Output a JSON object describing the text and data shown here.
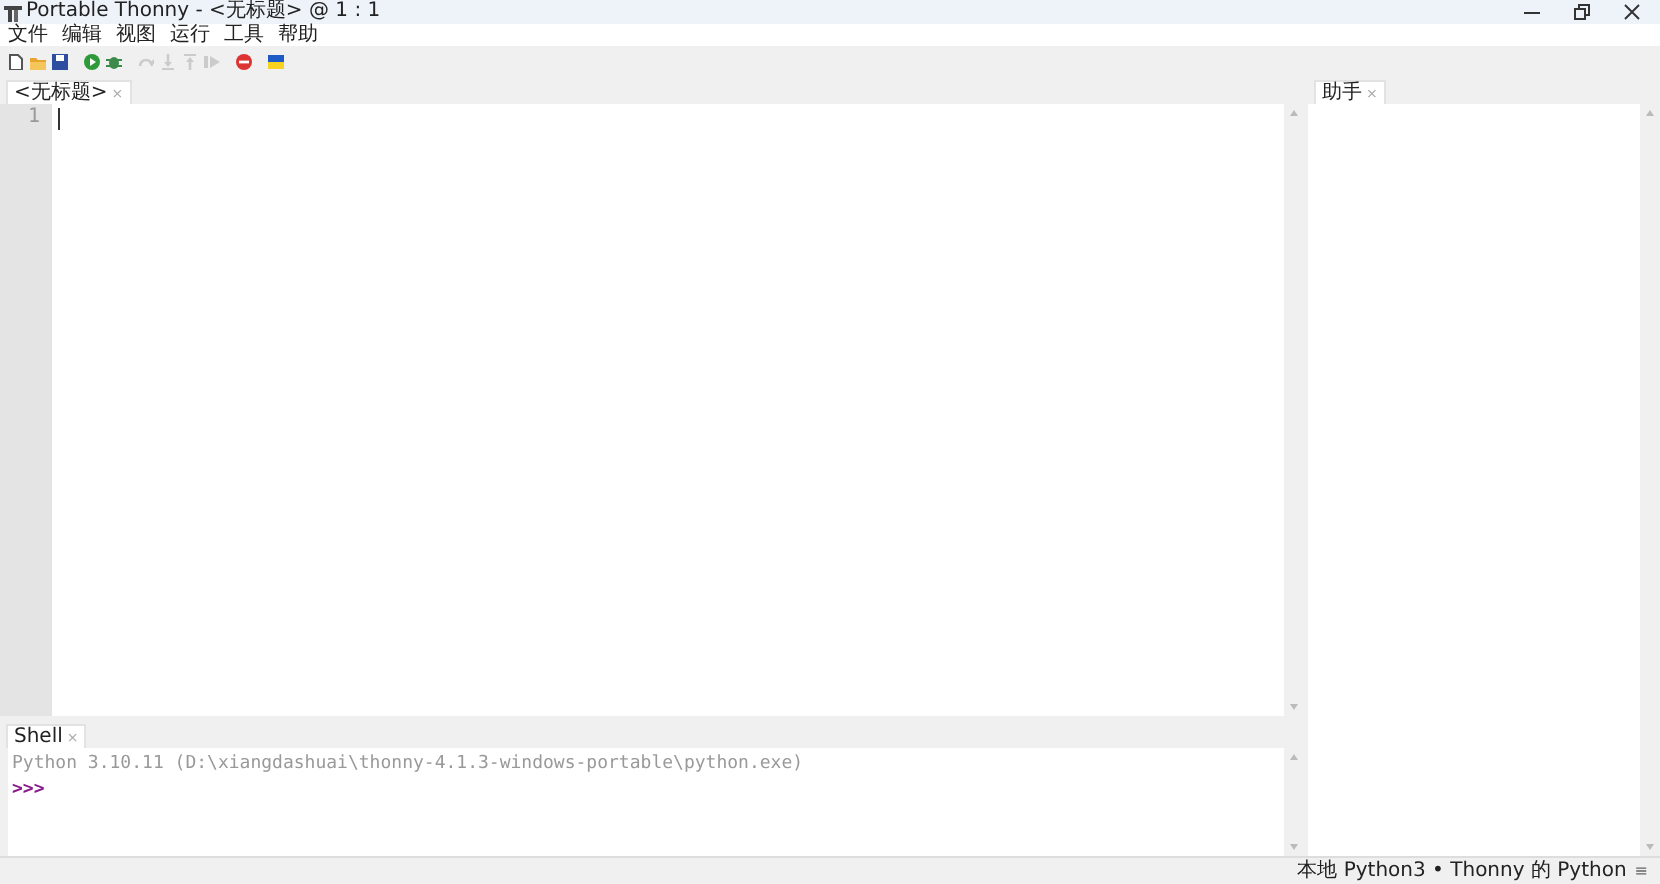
{
  "window": {
    "title": "Portable Thonny  -  <无标题>  @  1 : 1"
  },
  "menu": [
    {
      "label": "文件"
    },
    {
      "label": "编辑"
    },
    {
      "label": "视图"
    },
    {
      "label": "运行"
    },
    {
      "label": "工具"
    },
    {
      "label": "帮助"
    }
  ],
  "toolbar": [
    {
      "kind": "new",
      "disabled": false
    },
    {
      "kind": "open",
      "disabled": false
    },
    {
      "kind": "save",
      "disabled": false
    },
    {
      "kind": "run",
      "disabled": false
    },
    {
      "kind": "debug",
      "disabled": false
    },
    {
      "kind": "step_over",
      "disabled": true
    },
    {
      "kind": "step_into",
      "disabled": true
    },
    {
      "kind": "step_out",
      "disabled": true
    },
    {
      "kind": "resume",
      "disabled": true
    },
    {
      "kind": "stop",
      "disabled": false
    },
    {
      "kind": "flag",
      "disabled": false
    }
  ],
  "editor": {
    "tab": {
      "label": "<无标题>",
      "close": "×"
    },
    "line_numbers": [
      "1"
    ]
  },
  "shell": {
    "tab": {
      "label": "Shell",
      "close": "×"
    },
    "banner": "Python 3.10.11 (D:\\xiangdashuai\\thonny-4.1.3-windows-portable\\python.exe)",
    "prompt": ">>>"
  },
  "assistant": {
    "tab": {
      "label": "助手",
      "close": "×"
    }
  },
  "status_bar": {
    "interpreter": "本地 Python3  •  Thonny 的 Python",
    "menu_glyph": "≡"
  }
}
